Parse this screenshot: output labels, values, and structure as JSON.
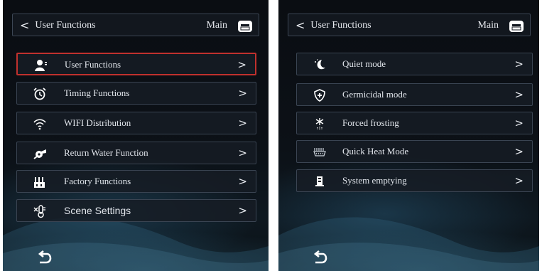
{
  "left_panel": {
    "header": {
      "back_title": "User Functions",
      "main_label": "Main"
    },
    "items": [
      {
        "label": "User Functions",
        "icon": "user-icon",
        "selected": true
      },
      {
        "label": "Timing Functions",
        "icon": "alarm-clock-icon"
      },
      {
        "label": "WIFI Distribution",
        "icon": "wifi-icon"
      },
      {
        "label": "Return Water Function",
        "icon": "water-pump-icon"
      },
      {
        "label": "Factory Functions",
        "icon": "factory-icon"
      },
      {
        "label": "Scene Settings",
        "icon": "thermometer-icon"
      }
    ]
  },
  "right_panel": {
    "header": {
      "back_title": "User Functions",
      "main_label": "Main"
    },
    "items": [
      {
        "label": "Quiet mode",
        "icon": "moon-icon"
      },
      {
        "label": "Germicidal mode",
        "icon": "shield-icon"
      },
      {
        "label": "Forced frosting",
        "icon": "snowflake-icon"
      },
      {
        "label": "Quick Heat Mode",
        "icon": "heater-icon"
      },
      {
        "label": "System emptying",
        "icon": "drain-icon"
      }
    ]
  },
  "colors": {
    "selected_border": "#c0312e",
    "text": "#e2e6ec",
    "border": "#3a4452"
  }
}
